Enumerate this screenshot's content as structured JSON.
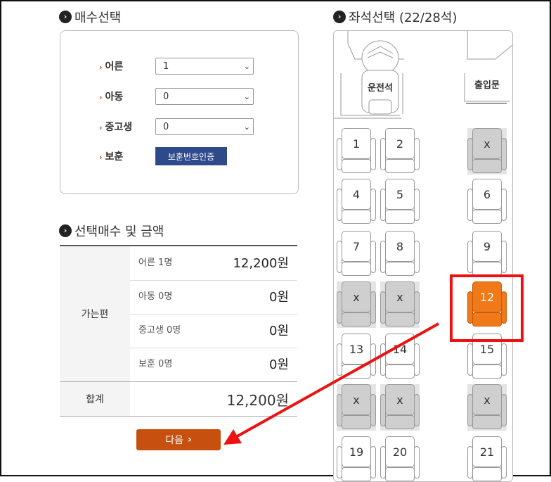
{
  "ticket_section": {
    "title": "매수선택",
    "rows": [
      {
        "label": "어른",
        "value": "1"
      },
      {
        "label": "아동",
        "value": "0"
      },
      {
        "label": "중고생",
        "value": "0"
      }
    ],
    "protect_label": "보훈",
    "protect_button": "보훈번호인증"
  },
  "summary_section": {
    "title": "선택매수 및 금액",
    "trip_label": "가는편",
    "rows": [
      {
        "label": "어른 1명",
        "value": "12,200원"
      },
      {
        "label": "아동 0명",
        "value": "0원"
      },
      {
        "label": "중고생 0명",
        "value": "0원"
      },
      {
        "label": "보훈 0명",
        "value": "0원"
      }
    ],
    "total_label": "합계",
    "total_value": "12,200원",
    "next_button": "다음"
  },
  "seat_section": {
    "title": "좌석선택 (22/28석)",
    "driver_label": "운전석",
    "door_label": "출입문",
    "seats": [
      {
        "label": "1",
        "state": "available"
      },
      {
        "label": "2",
        "state": "available"
      },
      {
        "label": "x",
        "state": "taken"
      },
      {
        "label": "4",
        "state": "available"
      },
      {
        "label": "5",
        "state": "available"
      },
      {
        "label": "6",
        "state": "available"
      },
      {
        "label": "7",
        "state": "available"
      },
      {
        "label": "8",
        "state": "available"
      },
      {
        "label": "9",
        "state": "available"
      },
      {
        "label": "x",
        "state": "taken"
      },
      {
        "label": "x",
        "state": "taken"
      },
      {
        "label": "12",
        "state": "selected"
      },
      {
        "label": "13",
        "state": "available"
      },
      {
        "label": "14",
        "state": "available"
      },
      {
        "label": "15",
        "state": "available"
      },
      {
        "label": "x",
        "state": "taken"
      },
      {
        "label": "x",
        "state": "taken"
      },
      {
        "label": "x",
        "state": "taken"
      },
      {
        "label": "19",
        "state": "available"
      },
      {
        "label": "20",
        "state": "available"
      },
      {
        "label": "21",
        "state": "available"
      }
    ]
  },
  "colors": {
    "accent": "#c8500f",
    "selected_seat": "#f07a1a",
    "highlight": "#ee1111",
    "protect_button": "#2f4a8a"
  }
}
